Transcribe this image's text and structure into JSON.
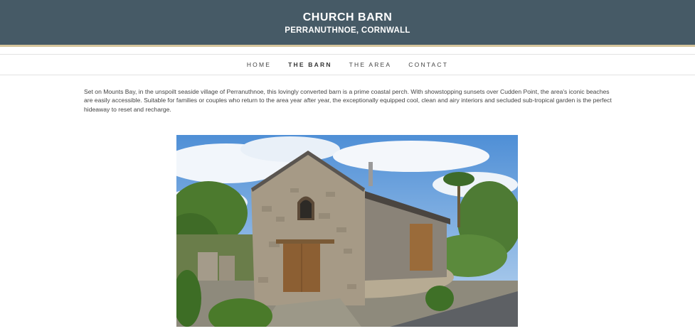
{
  "header": {
    "title": "CHURCH BARN",
    "subtitle": "PERRANUTHNOE, CORNWALL",
    "background_color": "#465a66",
    "accent_border_color": "#d6c59c"
  },
  "nav": {
    "items": [
      {
        "label": "HOME",
        "active": false
      },
      {
        "label": "THE BARN",
        "active": true
      },
      {
        "label": "THE AREA",
        "active": false
      },
      {
        "label": "CONTACT",
        "active": false
      }
    ]
  },
  "intro": {
    "text": "Set on Mounts Bay, in the unspoilt seaside village of Perranuthnoe, this lovingly converted barn is a prime coastal perch. With showstopping sunsets over Cudden Point, the area's iconic beaches are easily accessible. Suitable for families or couples who return to the area year after year, the exceptionally equipped cool, clean and airy interiors and secluded sub-tropical garden is the perfect hideaway to reset and recharge."
  }
}
